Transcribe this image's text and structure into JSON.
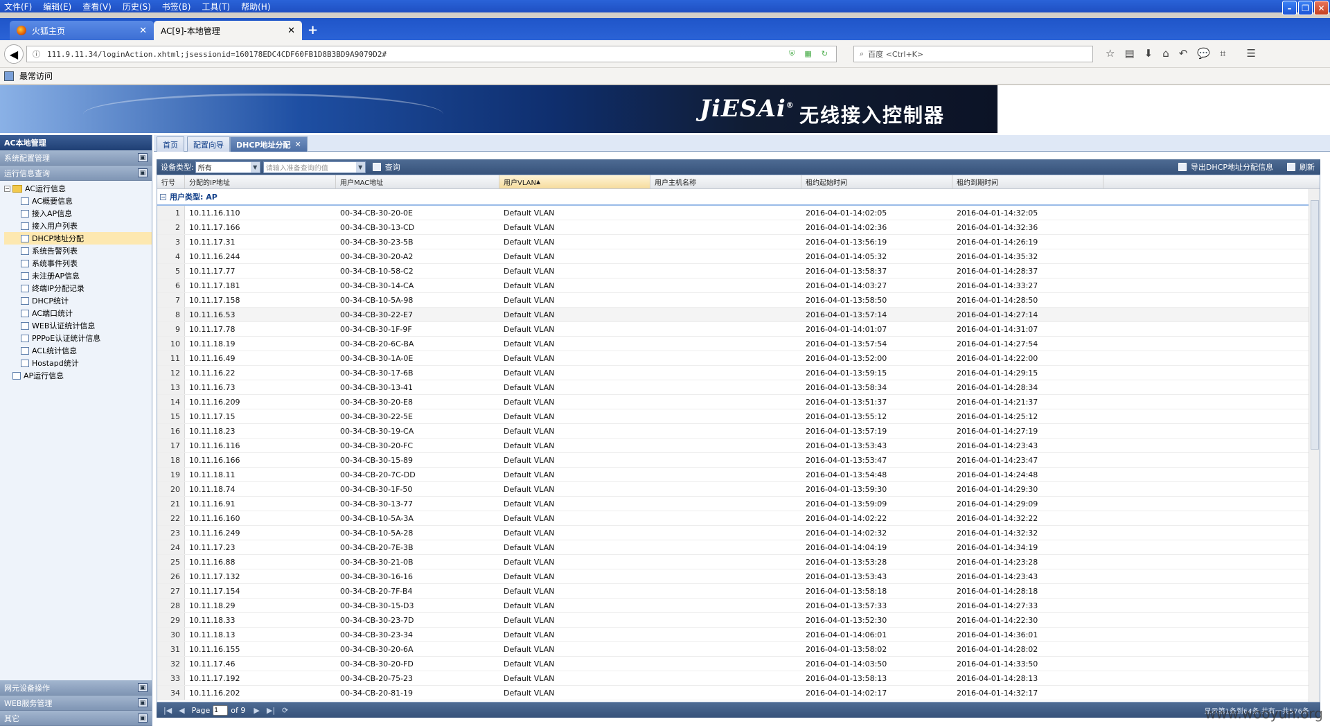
{
  "menu": [
    "文件(F)",
    "编辑(E)",
    "查看(V)",
    "历史(S)",
    "书签(B)",
    "工具(T)",
    "帮助(H)"
  ],
  "browser_tabs": [
    {
      "label": "火狐主页"
    },
    {
      "label": "AC[9]-本地管理"
    }
  ],
  "address": {
    "url": "111.9.11.34/loginAction.xhtml;jsessionid=160178EDC4CDF60FB1D8B3BD9A9079D2#",
    "search_placeholder": "百度 <Ctrl+K>"
  },
  "bookmarks": {
    "label": "最常访问"
  },
  "banner": {
    "logo": "JiESAi",
    "logo_mark": "®",
    "title": "无线接入控制器"
  },
  "sidebar": {
    "title": "AC本地管理",
    "sections_top": [
      "系统配置管理",
      "运行信息查询"
    ],
    "tree_root": "AC运行信息",
    "tree_items": [
      "AC概要信息",
      "接入AP信息",
      "接入用户列表",
      "DHCP地址分配",
      "系统告警列表",
      "系统事件列表",
      "未注册AP信息",
      "终端IP分配记录",
      "DHCP统计",
      "AC端口统计",
      "WEB认证统计信息",
      "PPPoE认证统计信息",
      "ACL统计信息",
      "Hostapd统计"
    ],
    "tree_root2": "AP运行信息",
    "sections_bottom": [
      "网元设备操作",
      "WEB服务管理",
      "其它"
    ]
  },
  "main_tabs": [
    "首页",
    "配置向导",
    "DHCP地址分配"
  ],
  "toolbar": {
    "device_type_label": "设备类型:",
    "device_type_value": "所有",
    "query_placeholder": "请输入准备查询的值",
    "query_label": "查询",
    "export_label": "导出DHCP地址分配信息",
    "refresh_label": "刷新"
  },
  "grid": {
    "columns": [
      "行号",
      "分配的IP地址",
      "用户MAC地址",
      "用户VLAN",
      "用户主机名称",
      "租约起始时间",
      "租约到期时间"
    ],
    "sorted_column_index": 3,
    "group_label": "用户类型: AP",
    "rows": [
      [
        "1",
        "10.11.16.110",
        "00-34-CB-30-20-0E",
        "Default VLAN",
        "",
        "2016-04-01-14:02:05",
        "2016-04-01-14:32:05"
      ],
      [
        "2",
        "10.11.17.166",
        "00-34-CB-30-13-CD",
        "Default VLAN",
        "",
        "2016-04-01-14:02:36",
        "2016-04-01-14:32:36"
      ],
      [
        "3",
        "10.11.17.31",
        "00-34-CB-30-23-5B",
        "Default VLAN",
        "",
        "2016-04-01-13:56:19",
        "2016-04-01-14:26:19"
      ],
      [
        "4",
        "10.11.16.244",
        "00-34-CB-30-20-A2",
        "Default VLAN",
        "",
        "2016-04-01-14:05:32",
        "2016-04-01-14:35:32"
      ],
      [
        "5",
        "10.11.17.77",
        "00-34-CB-10-58-C2",
        "Default VLAN",
        "",
        "2016-04-01-13:58:37",
        "2016-04-01-14:28:37"
      ],
      [
        "6",
        "10.11.17.181",
        "00-34-CB-30-14-CA",
        "Default VLAN",
        "",
        "2016-04-01-14:03:27",
        "2016-04-01-14:33:27"
      ],
      [
        "7",
        "10.11.17.158",
        "00-34-CB-10-5A-98",
        "Default VLAN",
        "",
        "2016-04-01-13:58:50",
        "2016-04-01-14:28:50"
      ],
      [
        "8",
        "10.11.16.53",
        "00-34-CB-30-22-E7",
        "Default VLAN",
        "",
        "2016-04-01-13:57:14",
        "2016-04-01-14:27:14"
      ],
      [
        "9",
        "10.11.17.78",
        "00-34-CB-30-1F-9F",
        "Default VLAN",
        "",
        "2016-04-01-14:01:07",
        "2016-04-01-14:31:07"
      ],
      [
        "10",
        "10.11.18.19",
        "00-34-CB-20-6C-BA",
        "Default VLAN",
        "",
        "2016-04-01-13:57:54",
        "2016-04-01-14:27:54"
      ],
      [
        "11",
        "10.11.16.49",
        "00-34-CB-30-1A-0E",
        "Default VLAN",
        "",
        "2016-04-01-13:52:00",
        "2016-04-01-14:22:00"
      ],
      [
        "12",
        "10.11.16.22",
        "00-34-CB-30-17-6B",
        "Default VLAN",
        "",
        "2016-04-01-13:59:15",
        "2016-04-01-14:29:15"
      ],
      [
        "13",
        "10.11.16.73",
        "00-34-CB-30-13-41",
        "Default VLAN",
        "",
        "2016-04-01-13:58:34",
        "2016-04-01-14:28:34"
      ],
      [
        "14",
        "10.11.16.209",
        "00-34-CB-30-20-E8",
        "Default VLAN",
        "",
        "2016-04-01-13:51:37",
        "2016-04-01-14:21:37"
      ],
      [
        "15",
        "10.11.17.15",
        "00-34-CB-30-22-5E",
        "Default VLAN",
        "",
        "2016-04-01-13:55:12",
        "2016-04-01-14:25:12"
      ],
      [
        "16",
        "10.11.18.23",
        "00-34-CB-30-19-CA",
        "Default VLAN",
        "",
        "2016-04-01-13:57:19",
        "2016-04-01-14:27:19"
      ],
      [
        "17",
        "10.11.16.116",
        "00-34-CB-30-20-FC",
        "Default VLAN",
        "",
        "2016-04-01-13:53:43",
        "2016-04-01-14:23:43"
      ],
      [
        "18",
        "10.11.16.166",
        "00-34-CB-30-15-89",
        "Default VLAN",
        "",
        "2016-04-01-13:53:47",
        "2016-04-01-14:23:47"
      ],
      [
        "19",
        "10.11.18.11",
        "00-34-CB-20-7C-DD",
        "Default VLAN",
        "",
        "2016-04-01-13:54:48",
        "2016-04-01-14:24:48"
      ],
      [
        "20",
        "10.11.18.74",
        "00-34-CB-30-1F-50",
        "Default VLAN",
        "",
        "2016-04-01-13:59:30",
        "2016-04-01-14:29:30"
      ],
      [
        "21",
        "10.11.16.91",
        "00-34-CB-30-13-77",
        "Default VLAN",
        "",
        "2016-04-01-13:59:09",
        "2016-04-01-14:29:09"
      ],
      [
        "22",
        "10.11.16.160",
        "00-34-CB-10-5A-3A",
        "Default VLAN",
        "",
        "2016-04-01-14:02:22",
        "2016-04-01-14:32:22"
      ],
      [
        "23",
        "10.11.16.249",
        "00-34-CB-10-5A-28",
        "Default VLAN",
        "",
        "2016-04-01-14:02:32",
        "2016-04-01-14:32:32"
      ],
      [
        "24",
        "10.11.17.23",
        "00-34-CB-20-7E-3B",
        "Default VLAN",
        "",
        "2016-04-01-14:04:19",
        "2016-04-01-14:34:19"
      ],
      [
        "25",
        "10.11.16.88",
        "00-34-CB-30-21-0B",
        "Default VLAN",
        "",
        "2016-04-01-13:53:28",
        "2016-04-01-14:23:28"
      ],
      [
        "26",
        "10.11.17.132",
        "00-34-CB-30-16-16",
        "Default VLAN",
        "",
        "2016-04-01-13:53:43",
        "2016-04-01-14:23:43"
      ],
      [
        "27",
        "10.11.17.154",
        "00-34-CB-20-7F-B4",
        "Default VLAN",
        "",
        "2016-04-01-13:58:18",
        "2016-04-01-14:28:18"
      ],
      [
        "28",
        "10.11.18.29",
        "00-34-CB-30-15-D3",
        "Default VLAN",
        "",
        "2016-04-01-13:57:33",
        "2016-04-01-14:27:33"
      ],
      [
        "29",
        "10.11.18.33",
        "00-34-CB-30-23-7D",
        "Default VLAN",
        "",
        "2016-04-01-13:52:30",
        "2016-04-01-14:22:30"
      ],
      [
        "30",
        "10.11.18.13",
        "00-34-CB-30-23-34",
        "Default VLAN",
        "",
        "2016-04-01-14:06:01",
        "2016-04-01-14:36:01"
      ],
      [
        "31",
        "10.11.16.155",
        "00-34-CB-30-20-6A",
        "Default VLAN",
        "",
        "2016-04-01-13:58:02",
        "2016-04-01-14:28:02"
      ],
      [
        "32",
        "10.11.17.46",
        "00-34-CB-30-20-FD",
        "Default VLAN",
        "",
        "2016-04-01-14:03:50",
        "2016-04-01-14:33:50"
      ],
      [
        "33",
        "10.11.17.192",
        "00-34-CB-20-75-23",
        "Default VLAN",
        "",
        "2016-04-01-13:58:13",
        "2016-04-01-14:28:13"
      ],
      [
        "34",
        "10.11.16.202",
        "00-34-CB-20-81-19",
        "Default VLAN",
        "",
        "2016-04-01-14:02:17",
        "2016-04-01-14:32:17"
      ]
    ]
  },
  "pager": {
    "page_label": "Page",
    "page_value": "1",
    "of_label": "of 9",
    "info": "显示第1条到64条,共有一共576条"
  },
  "watermark": "www.wooyun.org"
}
